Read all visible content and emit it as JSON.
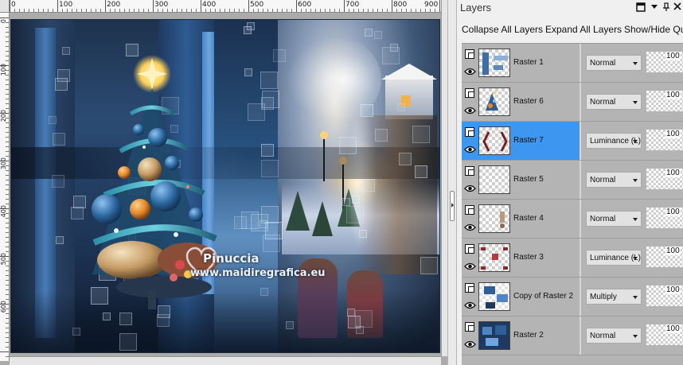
{
  "canvas": {
    "ruler_top_labels": [
      "0",
      "100",
      "200",
      "300",
      "400",
      "500",
      "600",
      "700",
      "800",
      "900"
    ],
    "ruler_left_labels": [
      "0",
      "100",
      "200",
      "300",
      "400",
      "500",
      "600"
    ],
    "watermark_name": "Pinuccia",
    "watermark_url": "www.maidiregrafica.eu"
  },
  "layers_panel": {
    "title": "Layers",
    "toolbar": {
      "collapse_all": "Collapse All Layers",
      "expand_all": "Expand All Layers",
      "show_hide": "Show/Hide Qu"
    },
    "layers": [
      {
        "name": "Raster 1",
        "blend": "Normal",
        "opacity": "100",
        "selected": false
      },
      {
        "name": "Raster 6",
        "blend": "Normal",
        "opacity": "100",
        "selected": false
      },
      {
        "name": "Raster 7",
        "blend": "Luminance (L)",
        "opacity": "100",
        "selected": true
      },
      {
        "name": "Raster 5",
        "blend": "Normal",
        "opacity": "100",
        "selected": false
      },
      {
        "name": "Raster 4",
        "blend": "Normal",
        "opacity": "100",
        "selected": false
      },
      {
        "name": "Raster 3",
        "blend": "Luminance (L)",
        "opacity": "100",
        "selected": false
      },
      {
        "name": "Copy of Raster 2",
        "blend": "Multiply",
        "opacity": "100",
        "selected": false
      },
      {
        "name": "Raster 2",
        "blend": "Normal",
        "opacity": "100",
        "selected": false
      }
    ]
  },
  "colors": {
    "selection": "#3d96f0",
    "layer_row_bg": "#b4b4b4"
  }
}
